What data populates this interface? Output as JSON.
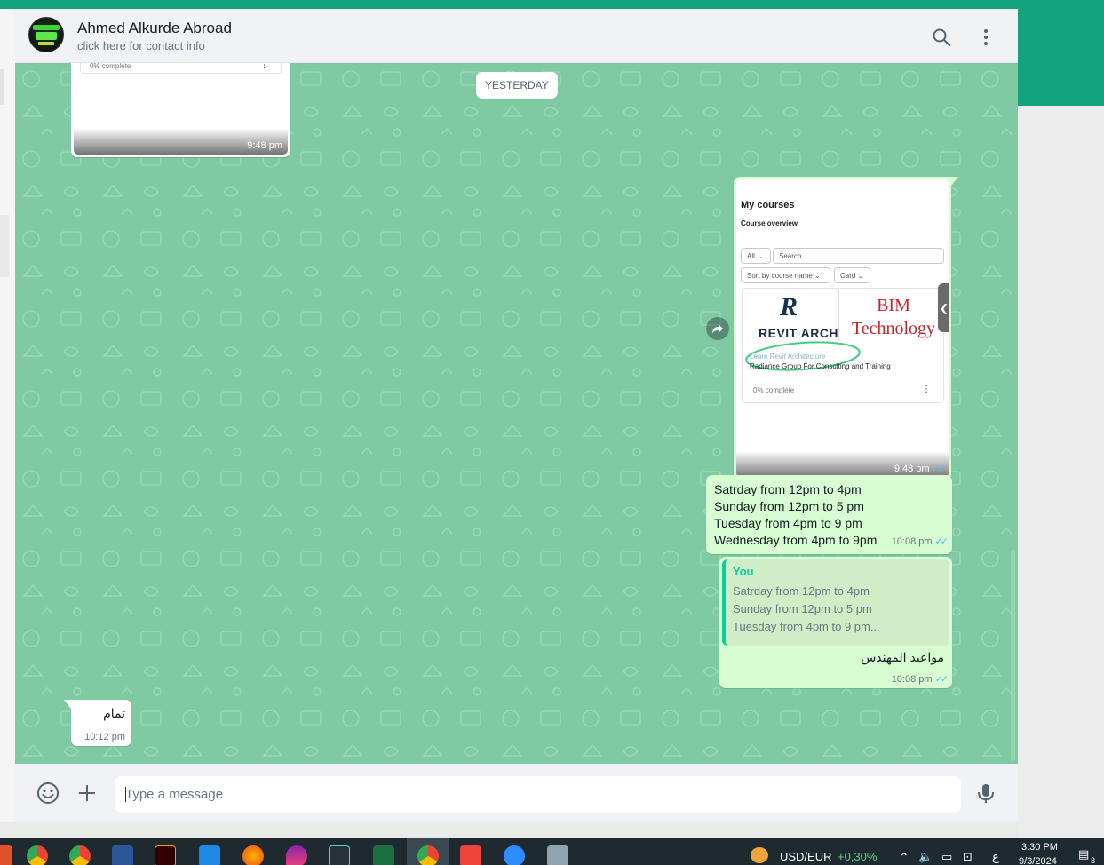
{
  "header": {
    "contact_name": "Ahmed Alkurde Abroad",
    "contact_sub": "click here for contact info",
    "icons": [
      "search-icon",
      "menu-icon"
    ]
  },
  "chat": {
    "date_label": "YESTERDAY",
    "incoming_image": {
      "progress_text": "0% complete",
      "time": "9:48 pm"
    },
    "outgoing_image": {
      "title": "My courses",
      "subtitle": "Course overview",
      "filter_all": "All",
      "search_placeholder": "Search",
      "sort_label": "Sort by course name",
      "view_label": "Card",
      "course_logo_letter": "R",
      "course_logo_text": "REVIT ARCH",
      "bim_line1": "BIM",
      "bim_line2": "Technology",
      "learn_text": "Learn Revit Architecture",
      "org_text": "Radiance Group For Consulting and Training",
      "progress_text": "0% complete",
      "time": "9:48 pm"
    },
    "schedule_message": {
      "lines": [
        "Satrday from 12pm to 4pm",
        "Sunday from 12pm to 5 pm",
        "Tuesday from 4pm to 9 pm",
        "Wednesday from 4pm to 9pm"
      ],
      "time": "10:08 pm"
    },
    "reply_message": {
      "quote_author": "You",
      "quote_lines": [
        "Satrday from 12pm to 4pm",
        "Sunday from 12pm to 5 pm",
        "Tuesday from 4pm to 9 pm..."
      ],
      "text": "مواعيد المهندس",
      "time": "10:08 pm"
    },
    "incoming_text": {
      "text": "تمام",
      "time": "10:12 pm"
    }
  },
  "composer": {
    "placeholder": "Type a message",
    "icons": [
      "emoji-icon",
      "attach-plus-icon",
      "microphone-icon"
    ]
  },
  "taskbar": {
    "currency_pair": "USD/EUR",
    "currency_change": "+0,30%",
    "language": "ع",
    "time": "3:30 PM",
    "date": "9/3/2024",
    "notification_count": "3",
    "apps": [
      "chrome-icon",
      "chrome-profile-icon",
      "word-icon",
      "illustrator-icon",
      "paint-icon",
      "firefox-icon",
      "drop-icon",
      "media-icon",
      "excel-icon",
      "chrome-active-icon",
      "anydesk-icon",
      "zoom-icon",
      "printer-icon"
    ]
  },
  "colors": {
    "brand_green": "#12a37e",
    "chat_bg": "#7fcaa3",
    "outgoing_bubble": "#d9fdd3",
    "read_tick": "#53bdeb",
    "quote_accent": "#06cf9c"
  }
}
